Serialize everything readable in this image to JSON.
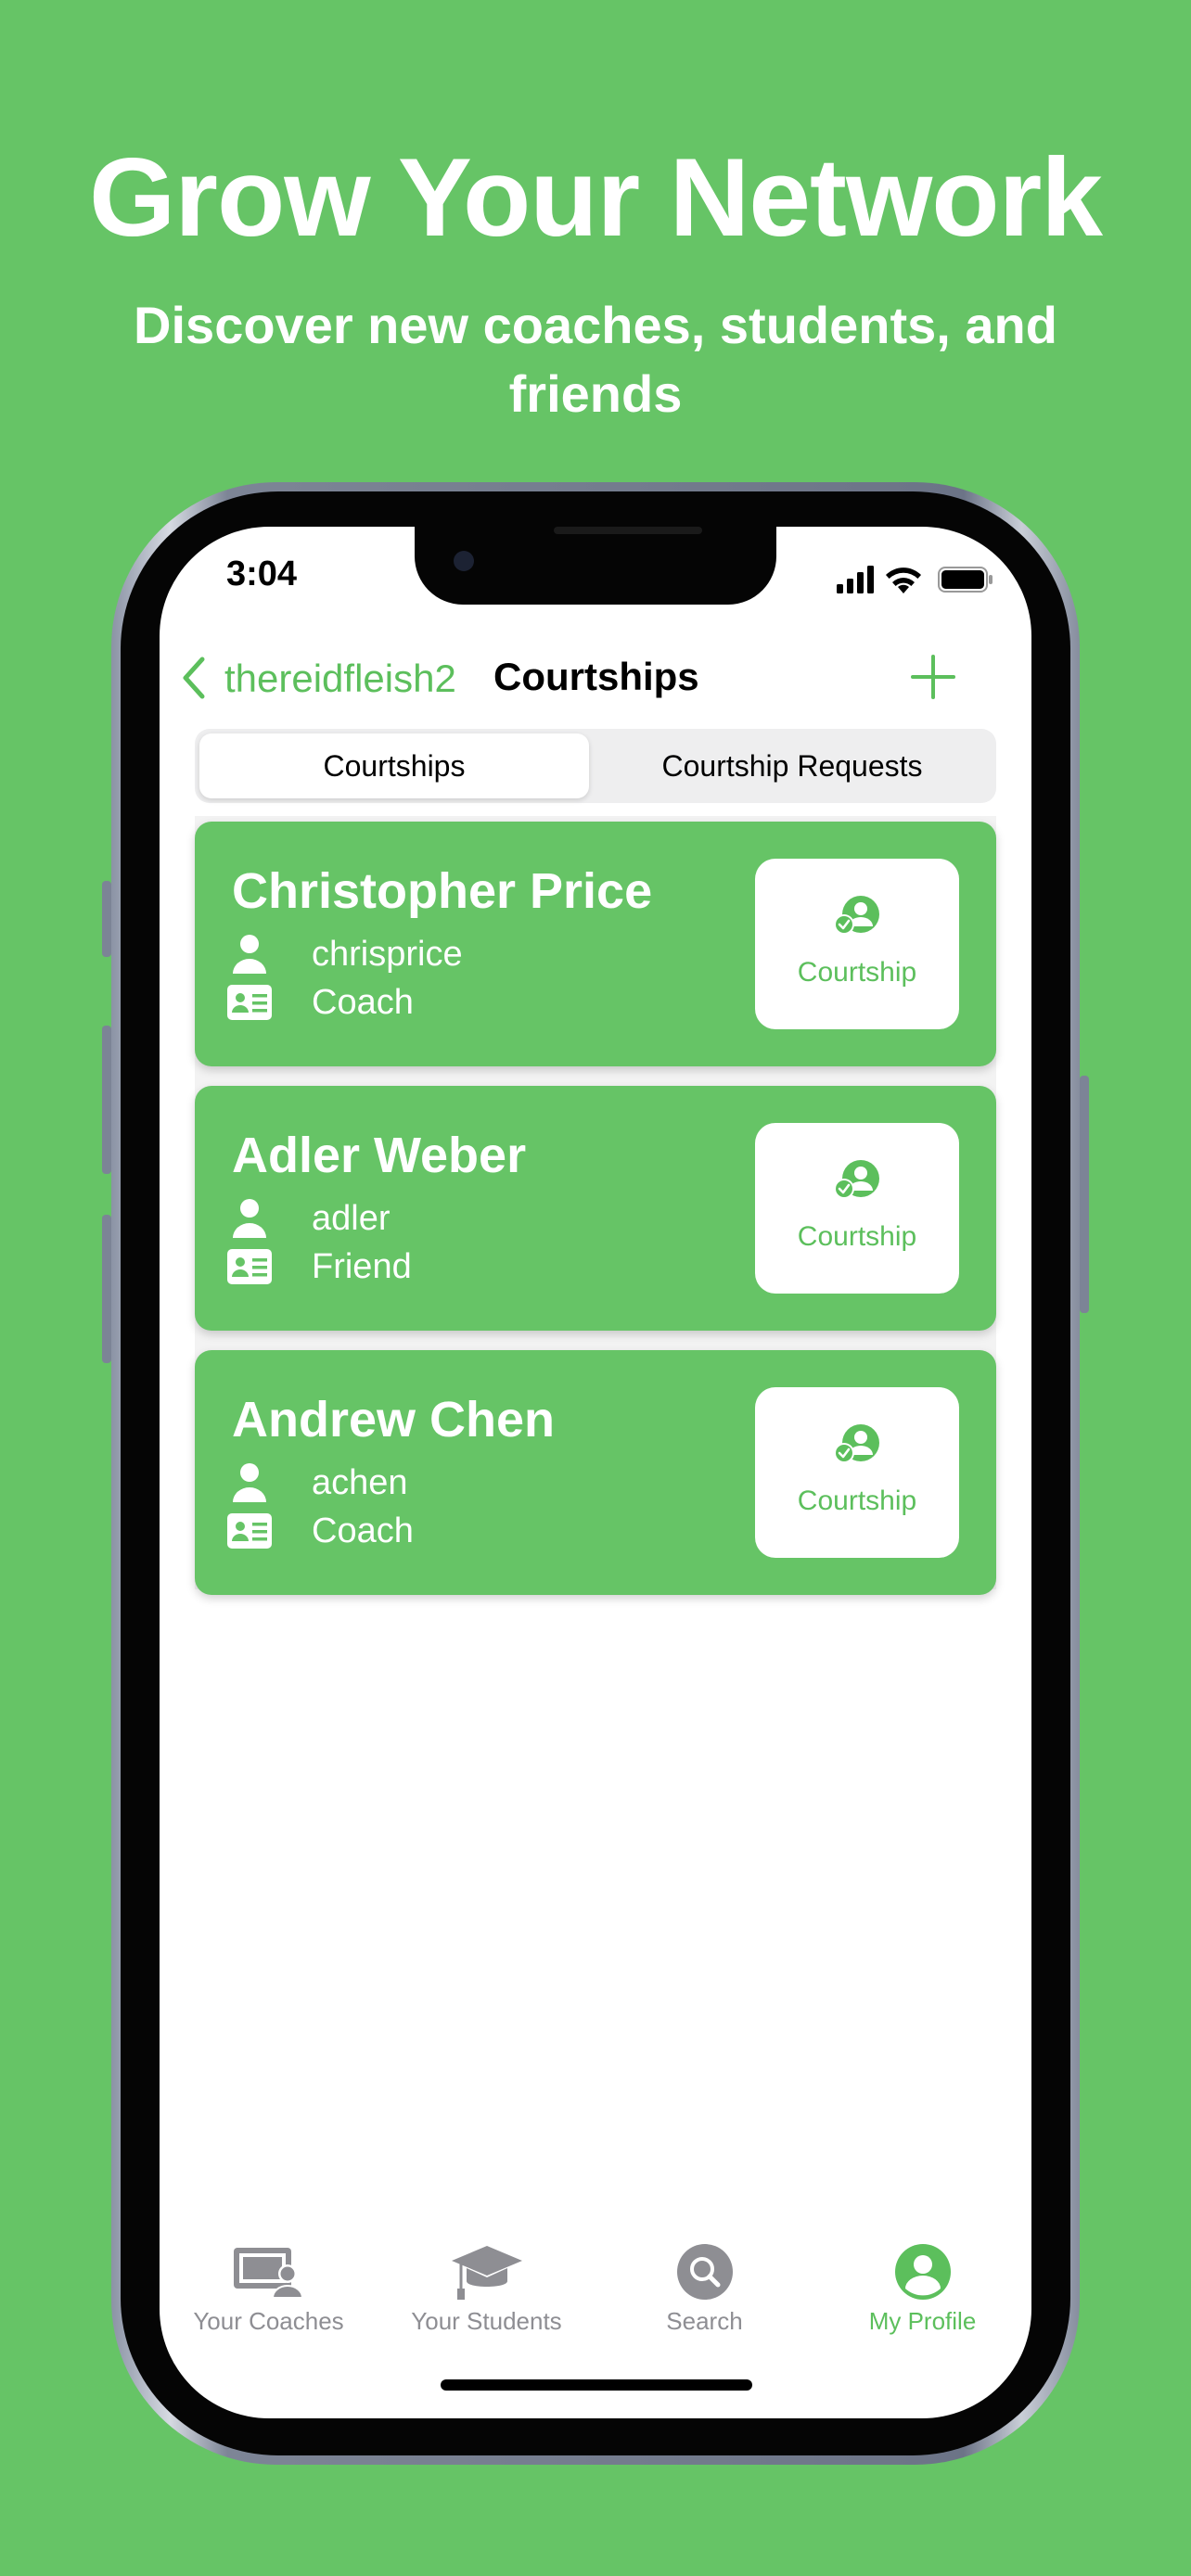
{
  "promo": {
    "headline": "Grow Your Network",
    "subhead": "Discover new coaches, students, and friends"
  },
  "status_bar": {
    "time": "3:04"
  },
  "nav": {
    "back_label": "thereidfleish2",
    "title": "Courtships"
  },
  "segments": {
    "active": "Courtships",
    "inactive": "Courtship Requests"
  },
  "cards": [
    {
      "name": "Christopher Price",
      "username": "chrisprice",
      "role": "Coach",
      "button_label": "Courtship"
    },
    {
      "name": "Adler Weber",
      "username": "adler",
      "role": "Friend",
      "button_label": "Courtship"
    },
    {
      "name": "Andrew Chen",
      "username": "achen",
      "role": "Coach",
      "button_label": "Courtship"
    }
  ],
  "tabbar": [
    {
      "label": "Your Coaches",
      "icon": "coaches-icon",
      "active": false
    },
    {
      "label": "Your Students",
      "icon": "graduation-cap-icon",
      "active": false
    },
    {
      "label": "Search",
      "icon": "search-icon",
      "active": false
    },
    {
      "label": "My Profile",
      "icon": "profile-icon",
      "active": true
    }
  ],
  "colors": {
    "brand_green": "#66c466",
    "accent_green": "#5cbf5c",
    "inactive_gray": "#8e8e93"
  }
}
